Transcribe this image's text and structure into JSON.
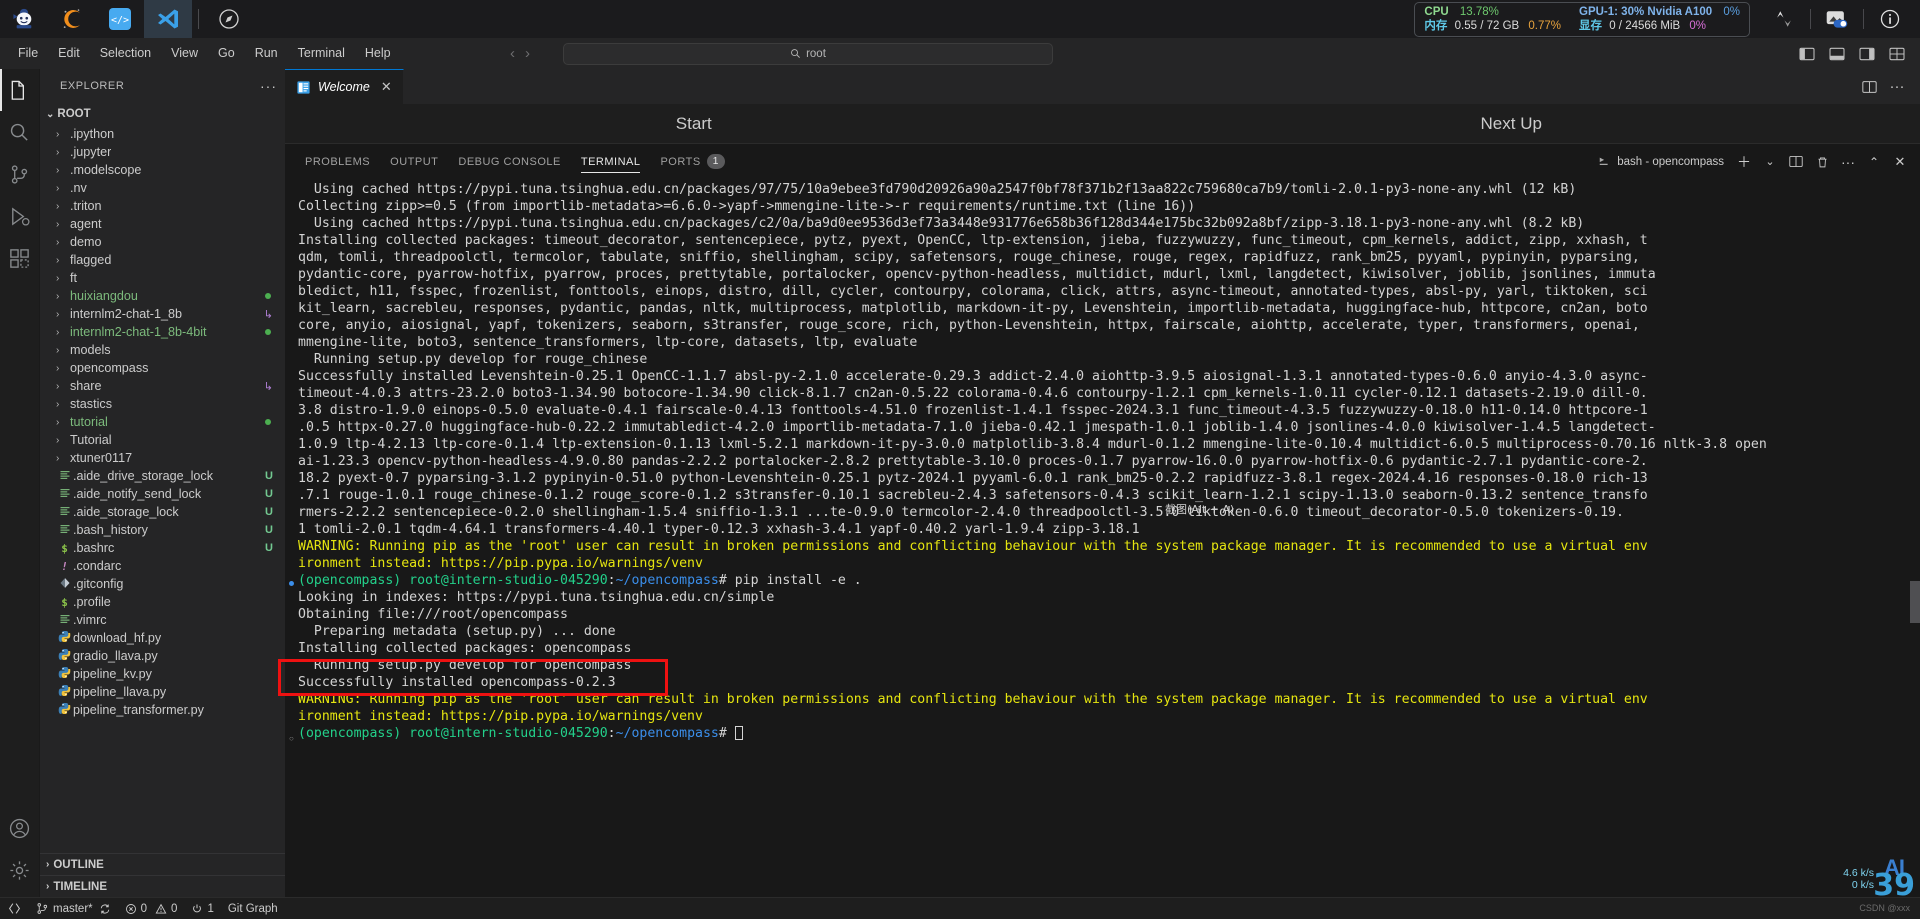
{
  "shell": {
    "tabs": [
      {
        "name": "intern-studio-logo",
        "label": ""
      },
      {
        "name": "conda-logo",
        "label": ""
      },
      {
        "name": "code-server-logo",
        "label": ""
      },
      {
        "name": "vscode-logo",
        "label": ""
      }
    ],
    "compass_tab_label": "",
    "resources": {
      "cpu_label": "CPU",
      "cpu_value": "13.78%",
      "mem_label": "内存",
      "mem_value": "0.55 / 72 GB",
      "mem_percent": "0.77%",
      "gpu_label": "GPU-1: 30% Nvidia A100",
      "gpu_percent": "0%",
      "vram_label": "显存",
      "vram_value": "0 / 24566 MiB",
      "vram_percent": "0%"
    },
    "icons": {
      "network_upload_download": "transfer-icon",
      "image_toggle": "image-toggle-icon",
      "info": "info-icon"
    }
  },
  "menubar": {
    "items": [
      "File",
      "Edit",
      "Selection",
      "View",
      "Go",
      "Run",
      "Terminal",
      "Help"
    ],
    "search_placeholder": "root",
    "search_value": "root",
    "back_arrow": "‹",
    "forward_arrow": "›"
  },
  "activitybar": {
    "items": [
      {
        "name": "explorer",
        "icon": "files-icon",
        "active": true
      },
      {
        "name": "search",
        "icon": "search-icon",
        "active": false
      },
      {
        "name": "source-control",
        "icon": "source-control-icon",
        "active": false
      },
      {
        "name": "run-debug",
        "icon": "run-debug-icon",
        "active": false
      },
      {
        "name": "extensions",
        "icon": "extensions-icon",
        "active": false
      }
    ],
    "bottom": [
      {
        "name": "accounts",
        "icon": "account-icon"
      },
      {
        "name": "settings",
        "icon": "gear-icon"
      }
    ]
  },
  "sidebar": {
    "title": "EXPLORER",
    "more_actions": "···",
    "root_label": "ROOT",
    "entries": [
      {
        "label": ".ipython",
        "type": "folder",
        "color": "default",
        "badge": ""
      },
      {
        "label": ".jupyter",
        "type": "folder",
        "color": "default",
        "badge": ""
      },
      {
        "label": ".modelscope",
        "type": "folder",
        "color": "default",
        "badge": ""
      },
      {
        "label": ".nv",
        "type": "folder",
        "color": "default",
        "badge": ""
      },
      {
        "label": ".triton",
        "type": "folder",
        "color": "default",
        "badge": ""
      },
      {
        "label": "agent",
        "type": "folder",
        "color": "default",
        "badge": ""
      },
      {
        "label": "demo",
        "type": "folder",
        "color": "default",
        "badge": ""
      },
      {
        "label": "flagged",
        "type": "folder",
        "color": "default",
        "badge": ""
      },
      {
        "label": "ft",
        "type": "folder",
        "color": "default",
        "badge": ""
      },
      {
        "label": "huixiangdou",
        "type": "folder",
        "color": "green",
        "badge": "dot"
      },
      {
        "label": "internlm2-chat-1_8b",
        "type": "folder",
        "color": "default",
        "badge": "arrow"
      },
      {
        "label": "internlm2-chat-1_8b-4bit",
        "type": "folder",
        "color": "green",
        "badge": "dot"
      },
      {
        "label": "models",
        "type": "folder",
        "color": "default",
        "badge": ""
      },
      {
        "label": "opencompass",
        "type": "folder",
        "color": "default",
        "badge": ""
      },
      {
        "label": "share",
        "type": "folder",
        "color": "default",
        "badge": "arrow"
      },
      {
        "label": "stastics",
        "type": "folder",
        "color": "default",
        "badge": ""
      },
      {
        "label": "tutorial",
        "type": "folder",
        "color": "green",
        "badge": "dot"
      },
      {
        "label": "Tutorial",
        "type": "folder",
        "color": "default",
        "badge": ""
      },
      {
        "label": "xtuner0117",
        "type": "folder",
        "color": "default",
        "badge": ""
      },
      {
        "label": ".aide_drive_storage_lock",
        "type": "file",
        "icon": "lines",
        "color": "default",
        "badge": "U"
      },
      {
        "label": ".aide_notify_send_lock",
        "type": "file",
        "icon": "lines",
        "color": "default",
        "badge": "U"
      },
      {
        "label": ".aide_storage_lock",
        "type": "file",
        "icon": "lines",
        "color": "default",
        "badge": "U"
      },
      {
        "label": ".bash_history",
        "type": "file",
        "icon": "lines",
        "color": "default",
        "badge": "U"
      },
      {
        "label": ".bashrc",
        "type": "file",
        "icon": "shell",
        "color": "default",
        "badge": "U"
      },
      {
        "label": ".condarc",
        "type": "file",
        "icon": "config",
        "color": "default",
        "badge": ""
      },
      {
        "label": ".gitconfig",
        "type": "file",
        "icon": "git",
        "color": "default",
        "badge": ""
      },
      {
        "label": ".profile",
        "type": "file",
        "icon": "shell",
        "color": "default",
        "badge": ""
      },
      {
        "label": ".vimrc",
        "type": "file",
        "icon": "lines",
        "color": "default",
        "badge": ""
      },
      {
        "label": "download_hf.py",
        "type": "file",
        "icon": "python",
        "color": "default",
        "badge": ""
      },
      {
        "label": "gradio_llava.py",
        "type": "file",
        "icon": "python",
        "color": "default",
        "badge": ""
      },
      {
        "label": "pipeline_kv.py",
        "type": "file",
        "icon": "python",
        "color": "default",
        "badge": ""
      },
      {
        "label": "pipeline_llava.py",
        "type": "file",
        "icon": "python",
        "color": "default",
        "badge": ""
      },
      {
        "label": "pipeline_transformer.py",
        "type": "file",
        "icon": "python",
        "color": "default",
        "badge": ""
      }
    ],
    "sections": [
      "OUTLINE",
      "TIMELINE"
    ]
  },
  "editor": {
    "tab_label": "Welcome",
    "tab_close": "✕",
    "welcome_columns": [
      "Start",
      "Next Up"
    ],
    "right_icons": [
      "split-editor-icon",
      "more-actions-icon"
    ]
  },
  "panel": {
    "tabs": [
      {
        "label": "PROBLEMS",
        "active": false,
        "badge": ""
      },
      {
        "label": "OUTPUT",
        "active": false,
        "badge": ""
      },
      {
        "label": "DEBUG CONSOLE",
        "active": false,
        "badge": ""
      },
      {
        "label": "TERMINAL",
        "active": true,
        "badge": ""
      },
      {
        "label": "PORTS",
        "active": false,
        "badge": "1"
      }
    ],
    "terminal_name": "bash - opencompass",
    "controls": [
      "new-terminal-icon",
      "chevron-down-icon",
      "split-terminal-icon",
      "kill-terminal-icon",
      "more-actions-icon",
      "maximize-panel-icon",
      "close-panel-icon"
    ]
  },
  "terminal": {
    "lines": [
      {
        "text": "  Using cached https://pypi.tuna.tsinghua.edu.cn/packages/97/75/10a9ebee3fd790d20926a90a2547f0bf78f371b2f13aa822c759680ca7b9/tomli-2.0.1-py3-none-any.whl (12 kB)",
        "color": "white"
      },
      {
        "text": "Collecting zipp>=0.5 (from importlib-metadata>=6.6.0->yapf->mmengine-lite->-r requirements/runtime.txt (line 16))",
        "color": "white"
      },
      {
        "text": "  Using cached https://pypi.tuna.tsinghua.edu.cn/packages/c2/0a/ba9d0ee9536d3ef73a3448e931776e658b36f128d344e175bc32b092a8bf/zipp-3.18.1-py3-none-any.whl (8.2 kB)",
        "color": "white"
      },
      {
        "text": "Installing collected packages: timeout_decorator, sentencepiece, pytz, pyext, OpenCC, ltp-extension, jieba, fuzzywuzzy, func_timeout, cpm_kernels, addict, zipp, xxhash, t",
        "color": "white"
      },
      {
        "text": "qdm, tomli, threadpoolctl, termcolor, tabulate, sniffio, shellingham, scipy, safetensors, rouge_chinese, rouge, regex, rapidfuzz, rank_bm25, pyyaml, pypinyin, pyparsing,",
        "color": "white"
      },
      {
        "text": "pydantic-core, pyarrow-hotfix, pyarrow, proces, prettytable, portalocker, opencv-python-headless, multidict, mdurl, lxml, langdetect, kiwisolver, joblib, jsonlines, immuta",
        "color": "white"
      },
      {
        "text": "bledict, h11, fsspec, frozenlist, fonttools, einops, distro, dill, cycler, contourpy, colorama, click, attrs, async-timeout, annotated-types, absl-py, yarl, tiktoken, sci",
        "color": "white"
      },
      {
        "text": "kit_learn, sacrebleu, responses, pydantic, pandas, nltk, multiprocess, matplotlib, markdown-it-py, Levenshtein, importlib-metadata, huggingface-hub, httpcore, cn2an, boto",
        "color": "white"
      },
      {
        "text": "core, anyio, aiosignal, yapf, tokenizers, seaborn, s3transfer, rouge_score, rich, python-Levenshtein, httpx, fairscale, aiohttp, accelerate, typer, transformers, openai,",
        "color": "white"
      },
      {
        "text": "mmengine-lite, boto3, sentence_transformers, ltp-core, datasets, ltp, evaluate",
        "color": "white"
      },
      {
        "text": "  Running setup.py develop for rouge_chinese",
        "color": "white"
      },
      {
        "text": "Successfully installed Levenshtein-0.25.1 OpenCC-1.1.7 absl-py-2.1.0 accelerate-0.29.3 addict-2.4.0 aiohttp-3.9.5 aiosignal-1.3.1 annotated-types-0.6.0 anyio-4.3.0 async-",
        "color": "white"
      },
      {
        "text": "timeout-4.0.3 attrs-23.2.0 boto3-1.34.90 botocore-1.34.90 click-8.1.7 cn2an-0.5.22 colorama-0.4.6 contourpy-1.2.1 cpm_kernels-1.0.11 cycler-0.12.1 datasets-2.19.0 dill-0.",
        "color": "white"
      },
      {
        "text": "3.8 distro-1.9.0 einops-0.5.0 evaluate-0.4.1 fairscale-0.4.13 fonttools-4.51.0 frozenlist-1.4.1 fsspec-2024.3.1 func_timeout-4.3.5 fuzzywuzzy-0.18.0 h11-0.14.0 httpcore-1",
        "color": "white"
      },
      {
        "text": ".0.5 httpx-0.27.0 huggingface-hub-0.22.2 immutabledict-4.2.0 importlib-metadata-7.1.0 jieba-0.42.1 jmespath-1.0.1 joblib-1.4.0 jsonlines-4.0.0 kiwisolver-1.4.5 langdetect-",
        "color": "white"
      },
      {
        "text": "1.0.9 ltp-4.2.13 ltp-core-0.1.4 ltp-extension-0.1.13 lxml-5.2.1 markdown-it-py-3.0.0 matplotlib-3.8.4 mdurl-0.1.2 mmengine-lite-0.10.4 multidict-6.0.5 multiprocess-0.70.16 nltk-3.8 open",
        "color": "white"
      },
      {
        "text": "ai-1.23.3 opencv-python-headless-4.9.0.80 pandas-2.2.2 portalocker-2.8.2 prettytable-3.10.0 proces-0.1.7 pyarrow-16.0.0 pyarrow-hotfix-0.6 pydantic-2.7.1 pydantic-core-2.",
        "color": "white"
      },
      {
        "text": "18.2 pyext-0.7 pyparsing-3.1.2 pypinyin-0.51.0 python-Levenshtein-0.25.1 pytz-2024.1 pyyaml-6.0.1 rank_bm25-0.2.2 rapidfuzz-3.8.1 regex-2024.4.16 responses-0.18.0 rich-13",
        "color": "white"
      },
      {
        "text": ".7.1 rouge-1.0.1 rouge_chinese-0.1.2 rouge_score-0.1.2 s3transfer-0.10.1 sacrebleu-2.4.3 safetensors-0.4.3 scikit_learn-1.2.1 scipy-1.13.0 seaborn-0.13.2 sentence_transfo",
        "color": "white"
      },
      {
        "text": "rmers-2.2.2 sentencepiece-0.2.0 shellingham-1.5.4 sniffio-1.3.1 ...te-0.9.0 termcolor-2.4.0 threadpoolctl-3.5.0 tiktoken-0.6.0 timeout_decorator-0.5.0 tokenizers-0.19.",
        "color": "white"
      },
      {
        "text": "1 tomli-2.0.1 tqdm-4.64.1 transformers-4.40.1 typer-0.12.3 xxhash-3.4.1 yapf-0.40.2 yarl-1.9.4 zipp-3.18.1",
        "color": "white"
      },
      {
        "text": "WARNING: Running pip as the 'root' user can result in broken permissions and conflicting behaviour with the system package manager. It is recommended to use a virtual env",
        "color": "yellow"
      },
      {
        "text": "ironment instead: https://pip.pypa.io/warnings/venv",
        "color": "yellow"
      },
      {
        "prompt": true,
        "env": "(opencompass) ",
        "user": "root@intern-studio-045290",
        "colon": ":",
        "path": "~/opencompass",
        "hash": "# ",
        "cmd": "pip install -e ."
      },
      {
        "text": "Looking in indexes: https://pypi.tuna.tsinghua.edu.cn/simple",
        "color": "white"
      },
      {
        "text": "Obtaining file:///root/opencompass",
        "color": "white"
      },
      {
        "text": "  Preparing metadata (setup.py) ... done",
        "color": "white"
      },
      {
        "text": "Installing collected packages: opencompass",
        "color": "white"
      },
      {
        "text": "  Running setup.py develop for opencompass",
        "color": "white"
      },
      {
        "text": "Successfully installed opencompass-0.2.3",
        "color": "white"
      },
      {
        "text": "WARNING: Running pip as the 'root' user can result in broken permissions and conflicting behaviour with the system package manager. It is recommended to use a virtual env",
        "color": "yellow"
      },
      {
        "text": "ironment instead: https://pip.pypa.io/warnings/venv",
        "color": "yellow"
      },
      {
        "prompt": true,
        "env": "(opencompass) ",
        "user": "root@intern-studio-045290",
        "colon": ":",
        "path": "~/opencompass",
        "hash": "# ",
        "cmd": "",
        "cursor": true
      }
    ],
    "capture_hint": "截图(Alt + A)",
    "colors": {
      "yellow": "#e5e510",
      "green": "#23d18b",
      "blue": "#3b8eea",
      "white": "#d4d4d4",
      "highlight_box": "#ee1111"
    }
  },
  "statusbar": {
    "remote_icon": "remote-icon",
    "branch": "master*",
    "sync_icon": "sync-icon",
    "errors": "0",
    "warnings": "0",
    "ports_label": "1",
    "git_graph": "Git Graph"
  },
  "overlay": {
    "net_speed": "4.6 k/s",
    "net_speed2": "0 k/s",
    "counter": "39",
    "ai_mark": "AI",
    "watermark": "CSDN @xxx"
  }
}
